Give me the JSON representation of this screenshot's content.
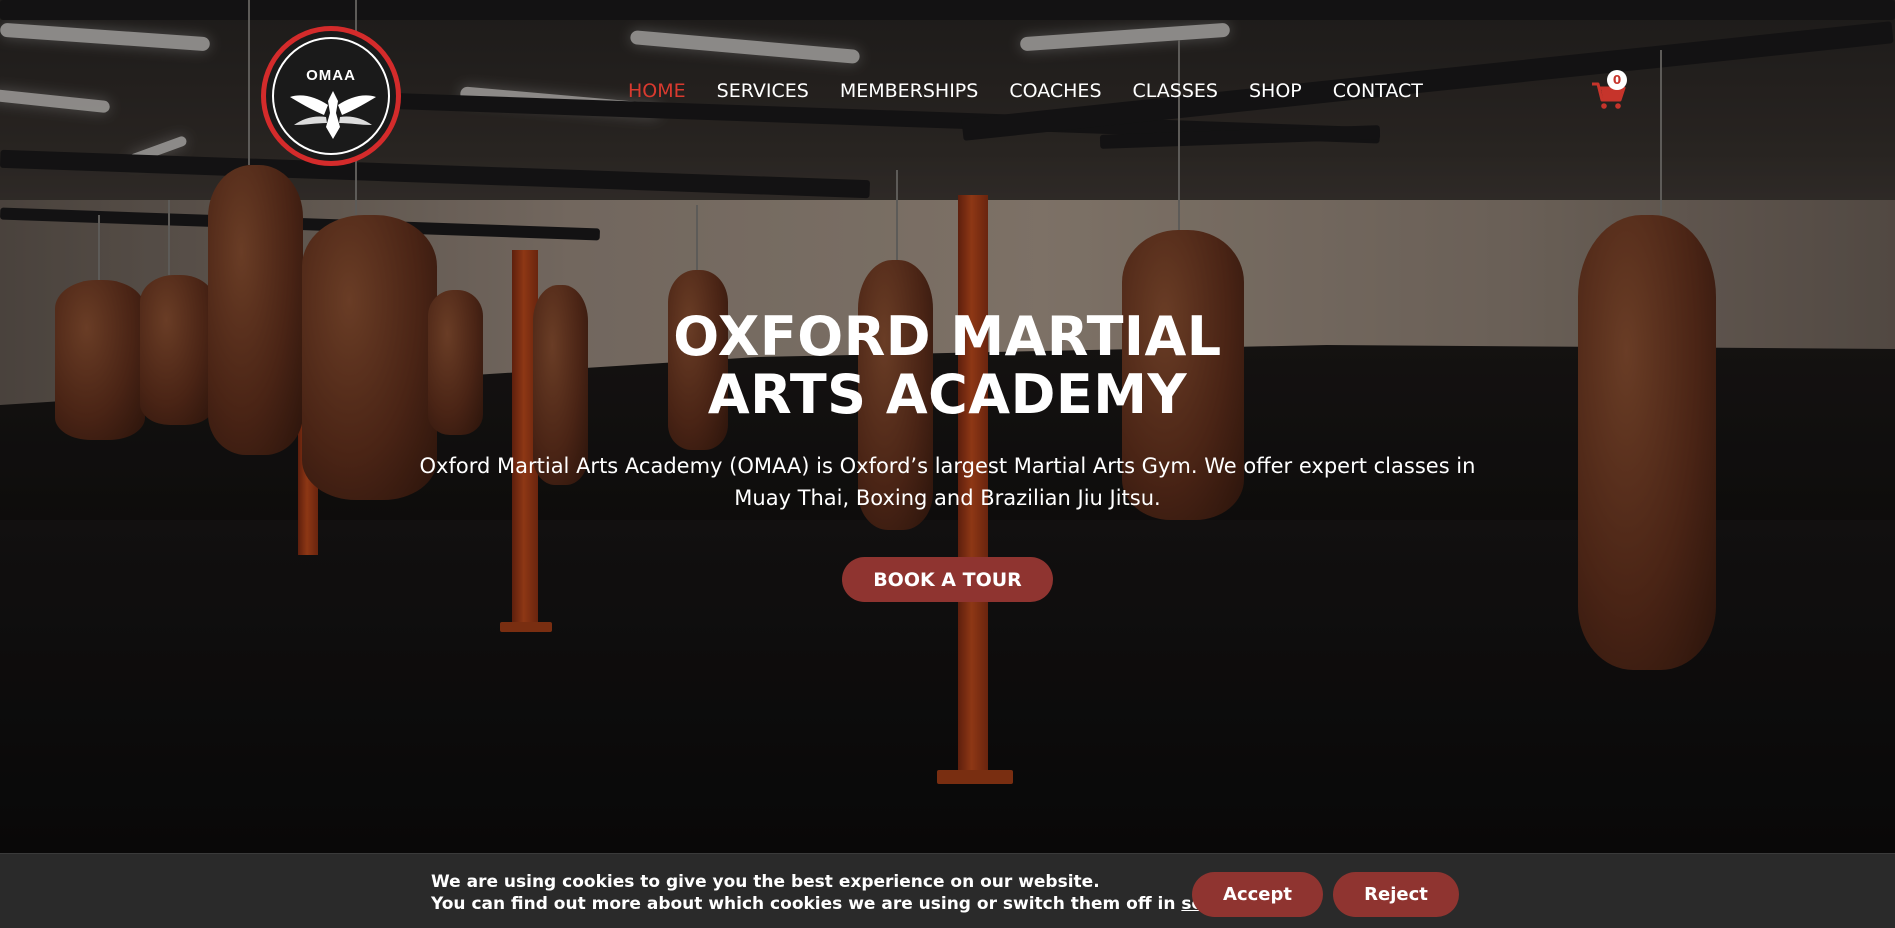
{
  "brand": {
    "logo_text": "OMAA",
    "logo_icon": "eagle-emblem-icon",
    "accent_color": "#d42b2b"
  },
  "nav": {
    "items": [
      {
        "label": "HOME",
        "active": true
      },
      {
        "label": "SERVICES",
        "active": false
      },
      {
        "label": "MEMBERSHIPS",
        "active": false
      },
      {
        "label": "COACHES",
        "active": false
      },
      {
        "label": "CLASSES",
        "active": false
      },
      {
        "label": "SHOP",
        "active": false
      },
      {
        "label": "CONTACT",
        "active": false
      }
    ],
    "active_color": "#d93a2f"
  },
  "cart": {
    "icon": "shopping-cart-icon",
    "count": "0"
  },
  "hero": {
    "title_line1": "OXFORD MARTIAL",
    "title_line2": "ARTS ACADEMY",
    "subtitle_line1": "Oxford Martial Arts Academy (OMAA) is Oxford’s largest Martial Arts Gym. We offer expert classes in",
    "subtitle_line2": "Muay Thai, Boxing and Brazilian Jiu Jitsu.",
    "cta_label": "BOOK A TOUR",
    "button_color": "#8f3430"
  },
  "cookie": {
    "line1": "We are using cookies to give you the best experience on our website.",
    "line2_prefix": "You can find out more about which cookies we are using or switch them off in ",
    "settings_link": "settings",
    "line2_suffix": ".",
    "accept_label": "Accept",
    "reject_label": "Reject"
  }
}
